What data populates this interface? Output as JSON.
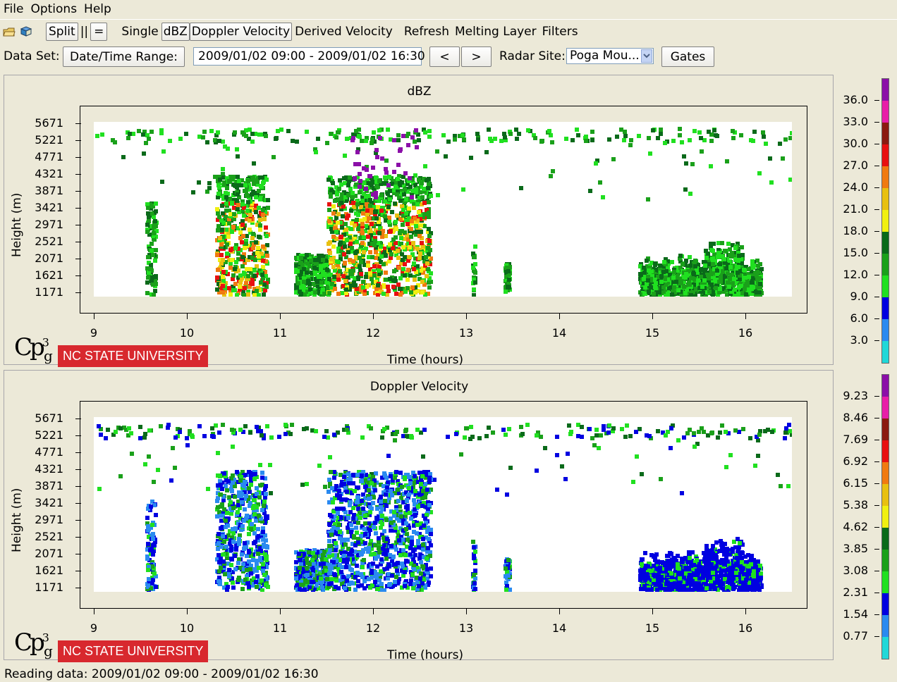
{
  "menu": [
    "File",
    "Options",
    "Help"
  ],
  "toolbar": {
    "split_label": "Split",
    "parallel_label": "||",
    "equal_label": "=",
    "single_label": "Single",
    "dbz_label": "dBZ",
    "doppler_label": "Doppler Velocity",
    "derived_label": "Derived Velocity",
    "refresh_label": "Refresh",
    "melting_label": "Melting Layer",
    "filters_label": "Filters",
    "icons": [
      "open-folder-icon",
      "book-icon"
    ]
  },
  "dataset": {
    "label": "Data Set:",
    "range_button": "Date/Time Range:",
    "range_value": "2009/01/02 09:00 - 2009/01/02 16:30",
    "prev": "<",
    "next": ">",
    "site_label": "Radar Site:",
    "site_value": "Poga Mou...",
    "gates_button": "Gates"
  },
  "logo": {
    "cp": "Cp",
    "sup": "3",
    "sub": "g",
    "university": "NC STATE UNIVERSITY"
  },
  "status": "Reading data: 2009/01/02 09:00 - 2009/01/02 16:30",
  "chart_data": [
    {
      "type": "heatmap",
      "title": "dBZ",
      "xlabel": "Time (hours)",
      "ylabel": "Height (m)",
      "xlim": [
        9,
        16.5
      ],
      "xticks": [
        "9",
        "10",
        "11",
        "12",
        "13",
        "14",
        "15",
        "16"
      ],
      "yticks": [
        "5671",
        "5221",
        "4771",
        "4321",
        "3871",
        "3421",
        "2971",
        "2521",
        "2071",
        "1621",
        "1171"
      ],
      "colorbar_labels": [
        "36.0",
        "33.0",
        "30.0",
        "27.0",
        "24.0",
        "21.0",
        "18.0",
        "15.0",
        "12.0",
        "9.0",
        "6.0",
        "3.0"
      ],
      "colorbar_colors": [
        "#8b0fa8",
        "#e81ea8",
        "#8b1a10",
        "#e81010",
        "#f07a10",
        "#e8c010",
        "#f0f010",
        "#0a6a1a",
        "#1aa01a",
        "#20e020",
        "#0000e0",
        "#2a8af0",
        "#20d8d8"
      ]
    },
    {
      "type": "heatmap",
      "title": "Doppler Velocity",
      "xlabel": "Time (hours)",
      "ylabel": "Height (m)",
      "xlim": [
        9,
        16.5
      ],
      "xticks": [
        "9",
        "10",
        "11",
        "12",
        "13",
        "14",
        "15",
        "16"
      ],
      "yticks": [
        "5671",
        "5221",
        "4771",
        "4321",
        "3871",
        "3421",
        "2971",
        "2521",
        "2071",
        "1621",
        "1171"
      ],
      "colorbar_labels": [
        "9.23",
        "8.46",
        "7.69",
        "6.92",
        "6.15",
        "5.38",
        "4.62",
        "3.85",
        "3.08",
        "2.31",
        "1.54",
        "0.77"
      ],
      "colorbar_colors": [
        "#8b0fa8",
        "#e81ea8",
        "#8b1a10",
        "#e81010",
        "#f07a10",
        "#e8c010",
        "#f0f010",
        "#0a6a1a",
        "#1aa01a",
        "#20e020",
        "#0000e0",
        "#2a8af0",
        "#20d8d8"
      ]
    }
  ]
}
